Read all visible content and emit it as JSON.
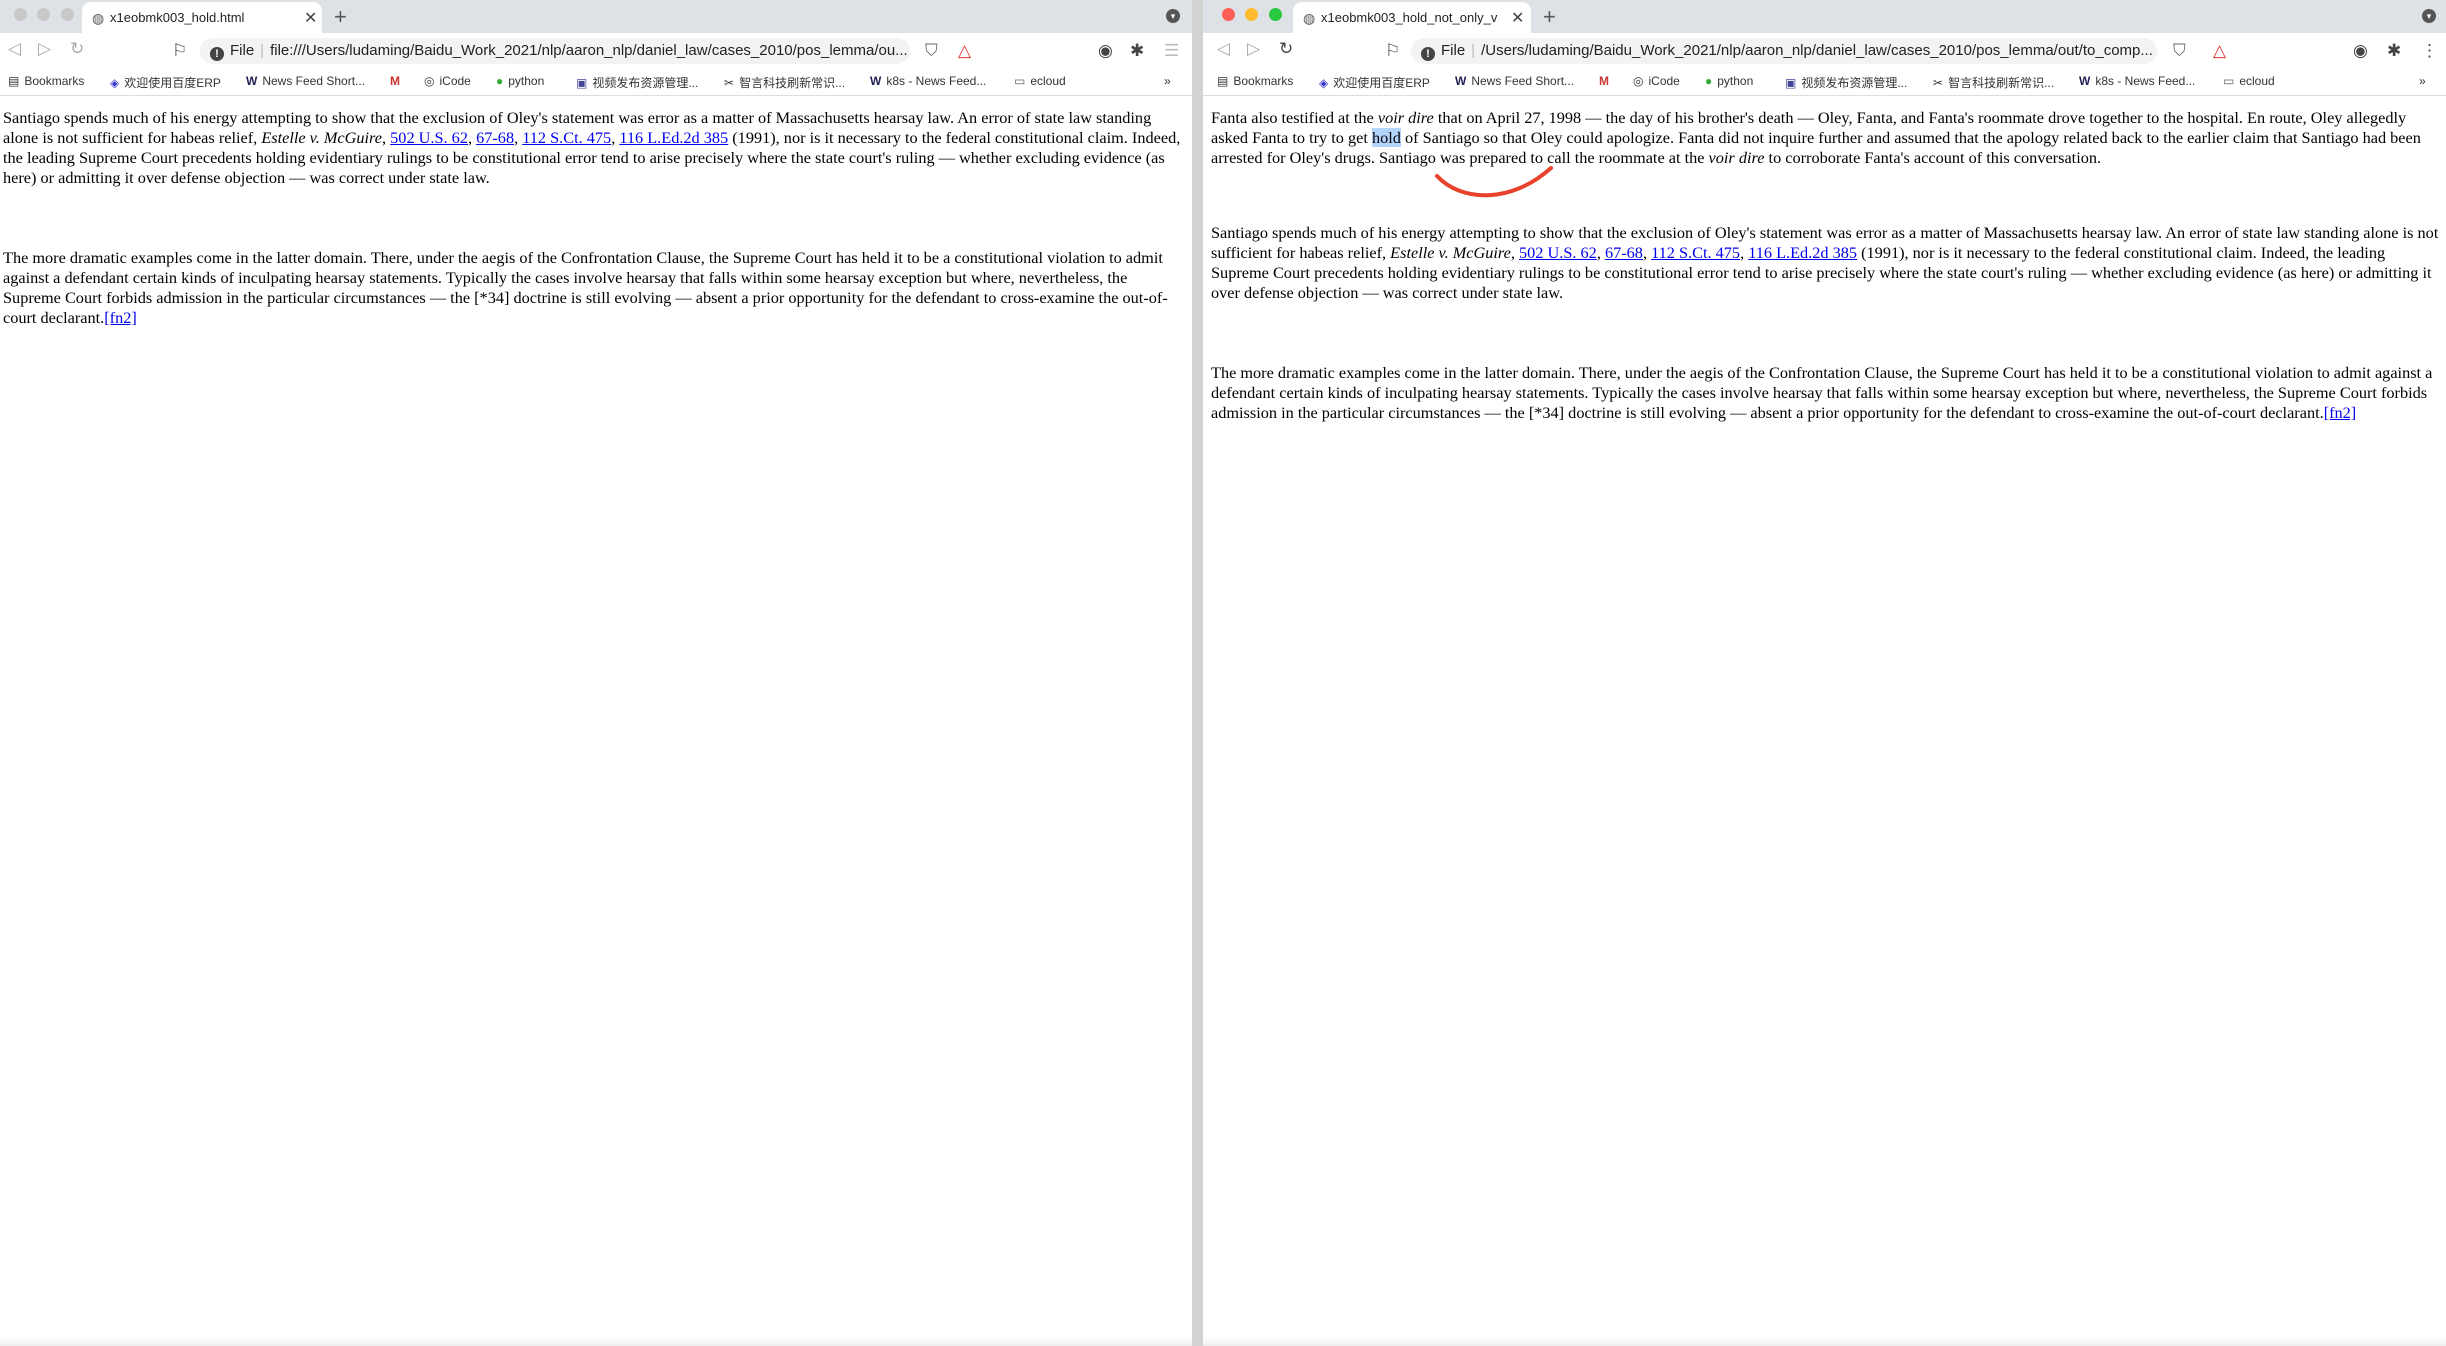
{
  "left_window": {
    "tab_title": "x1eobmk003_hold.html",
    "address_scheme": "File",
    "address_url": "file:///Users/ludaming/Baidu_Work_2021/nlp/aaron_nlp/daniel_law/cases_2010/pos_lemma/ou...",
    "paragraphs": [
      {
        "t1": "Santiago spends much of his energy attempting to show that the exclusion of Oley's statement was error as a matter of Massachusetts hearsay law. An error of state law standing alone is not sufficient for habeas relief, ",
        "case_name": "Estelle v. McGuire",
        "c1": ", ",
        "link1": "502 U.S. 62",
        "c2": ", ",
        "link2": "67-68",
        "c3": ", ",
        "link3": "112 S.Ct. 475",
        "c4": ", ",
        "link4": "116 L.Ed.2d 385",
        "t2": " (1991), nor is it necessary to the federal constitutional claim. Indeed, the leading Supreme Court precedents holding evidentiary rulings to be constitutional error tend to arise precisely where the state court's ruling — whether excluding evidence (as here) or admitting it over defense objection — was correct under state law."
      },
      {
        "t1": "The more dramatic examples come in the latter domain. There, under the aegis of the Confrontation Clause, the Supreme Court has held it to be a constitutional violation to admit against a defendant certain kinds of inculpating hearsay statements. Typically the cases involve hearsay that falls within some hearsay exception but where, nevertheless, the Supreme Court forbids admission in the particular circumstances — the [*34] doctrine is still evolving — absent a prior opportunity for the defendant to cross-examine the out-of-court declarant.",
        "fn": "[fn2]"
      }
    ]
  },
  "right_window": {
    "tab_title": "x1eobmk003_hold_not_only_v",
    "address_scheme": "File",
    "address_url": "/Users/ludaming/Baidu_Work_2021/nlp/aaron_nlp/daniel_law/cases_2010/pos_lemma/out/to_comp...",
    "first_paragraph": {
      "t1": "Fanta also testified at the ",
      "i1": "voir dire",
      "t2": " that on April 27, 1998 — the day of his brother's death — Oley, Fanta, and Fanta's roommate drove together to the hospital. En route, Oley allegedly asked Fanta to try to get ",
      "highlight": "hold",
      "t3": " of Santiago so that Oley could apologize. Fanta did not inquire further and assumed that the apology related back to the earlier claim that Santiago had been arrested for Oley's drugs. Santiago was prepared to call the roommate at the ",
      "i2": "voir dire",
      "t4": " to corroborate Fanta's account of this conversation."
    }
  },
  "bookmarks": [
    "Bookmarks",
    "欢迎使用百度ERP",
    "News Feed Short...",
    "iCode",
    "python",
    "视频发布资源管理...",
    "智言科技刷新常识...",
    "k8s - News Feed...",
    "ecloud"
  ],
  "bookmarks_overflow": "»",
  "colors": {
    "link": "#0000ee",
    "highlight": "#b3d4fc",
    "annotation": "#e8412c",
    "tabbar": "#dee1e6"
  }
}
